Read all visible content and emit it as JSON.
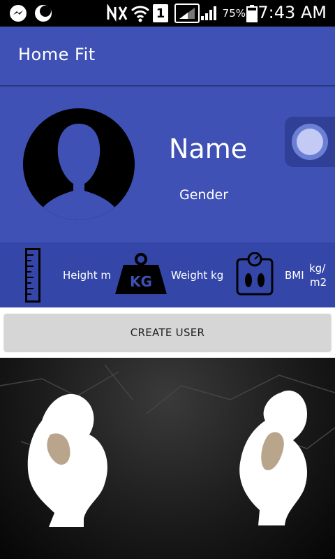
{
  "status_bar": {
    "battery_percent": "75%",
    "time": "7:43 AM",
    "sim_slot": "1",
    "icons": [
      "messenger-icon",
      "night-mode-icon",
      "nfc-icon",
      "wifi-icon",
      "sim-icon",
      "signal-icon",
      "signal-icon",
      "battery-icon"
    ]
  },
  "app_bar": {
    "title": "Home Fit"
  },
  "profile": {
    "name": "Name",
    "gender": "Gender"
  },
  "stats": {
    "height_label": "Height m",
    "weight_label": "Weight kg",
    "weight_icon_text": "KG",
    "bmi_label": "BMI",
    "bmi_unit_top": "kg/",
    "bmi_unit_bottom": "m2"
  },
  "actions": {
    "create_user_label": "CREATE USER"
  },
  "colors": {
    "primary": "#3f51b5",
    "primary_dark": "#3447a8",
    "button_bg": "#d6d6d6"
  }
}
